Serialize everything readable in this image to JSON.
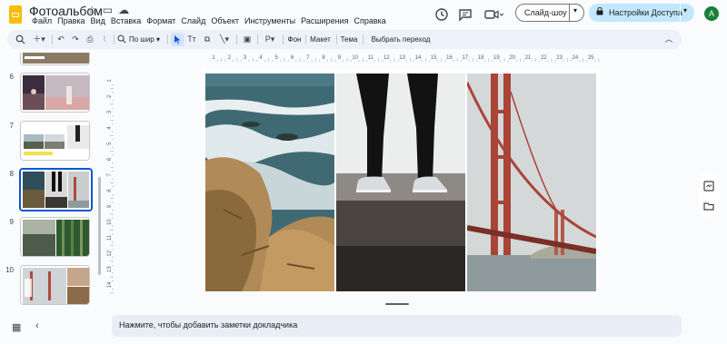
{
  "app": {
    "title": "Фотоальбом",
    "menu": [
      "Файл",
      "Правка",
      "Вид",
      "Вставка",
      "Формат",
      "Слайд",
      "Объект",
      "Инструменты",
      "Расширения",
      "Справка"
    ],
    "slideshow_label": "Слайд-шоу",
    "access_label": "Настройки Доступа",
    "avatar_letter": "A"
  },
  "toolbar": {
    "zoom_label": "По шир",
    "background_label": "Фон",
    "layout_label": "Макет",
    "theme_label": "Тема",
    "transition_label": "Выбрать переход"
  },
  "filmstrip": {
    "slides": [
      {
        "number": "6"
      },
      {
        "number": "7"
      },
      {
        "number": "8",
        "selected": true
      },
      {
        "number": "9"
      },
      {
        "number": "10"
      }
    ]
  },
  "ruler": {
    "h_ticks": [
      "1",
      "2",
      "3",
      "4",
      "5",
      "6",
      "7",
      "8",
      "9",
      "10",
      "11",
      "12",
      "13",
      "14",
      "15",
      "16",
      "17",
      "18",
      "19",
      "20",
      "21",
      "22",
      "23",
      "24",
      "25"
    ],
    "v_ticks": [
      "1",
      "2",
      "3",
      "4",
      "5",
      "6",
      "7",
      "8",
      "9",
      "10",
      "11",
      "12",
      "13",
      "14"
    ]
  },
  "notes": {
    "placeholder": "Нажмите, чтобы добавить заметки докладчика"
  },
  "colors": {
    "accent": "#0b57d0",
    "access_bg": "#c2e7ff",
    "toolbar_bg": "#edf2fa",
    "avatar": "#188038"
  }
}
